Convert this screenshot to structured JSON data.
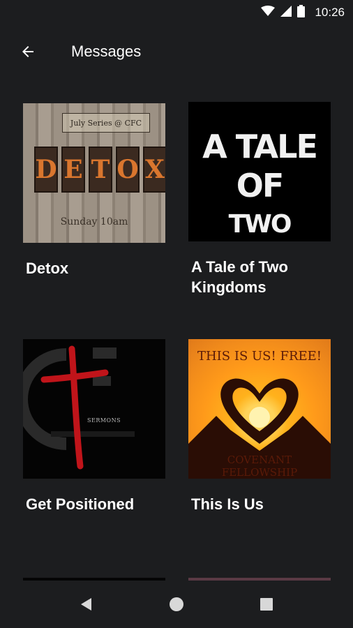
{
  "status_bar": {
    "time": "10:26"
  },
  "app_bar": {
    "title": "Messages"
  },
  "messages": [
    {
      "title": "Detox",
      "thumbnail": {
        "banner": "July Series @ CFC",
        "letters": [
          "D",
          "E",
          "T",
          "O",
          "X"
        ],
        "subtitle": "Sunday 10am"
      }
    },
    {
      "title": "A Tale of Two Kingdoms",
      "thumbnail": {
        "line1": "A TALE OF",
        "line2": "TWO KINGDOMS"
      }
    },
    {
      "title": "Get Positioned",
      "thumbnail": {
        "label": "SERMONS"
      }
    },
    {
      "title": "This Is Us",
      "thumbnail": {
        "top_text": "THIS IS US! FREE!",
        "bottom_text": "COVENANT FELLOWSHIP"
      }
    }
  ],
  "colors": {
    "background": "#1c1d1f",
    "text": "#ffffff",
    "detox_letter": "#d9762e",
    "cross_red": "#c0141a",
    "this_is_us_orange": "#f08a1b"
  },
  "icons": {
    "back": "arrow-left-icon",
    "nav_back": "triangle-back-icon",
    "nav_home": "circle-home-icon",
    "nav_recents": "square-recents-icon"
  }
}
